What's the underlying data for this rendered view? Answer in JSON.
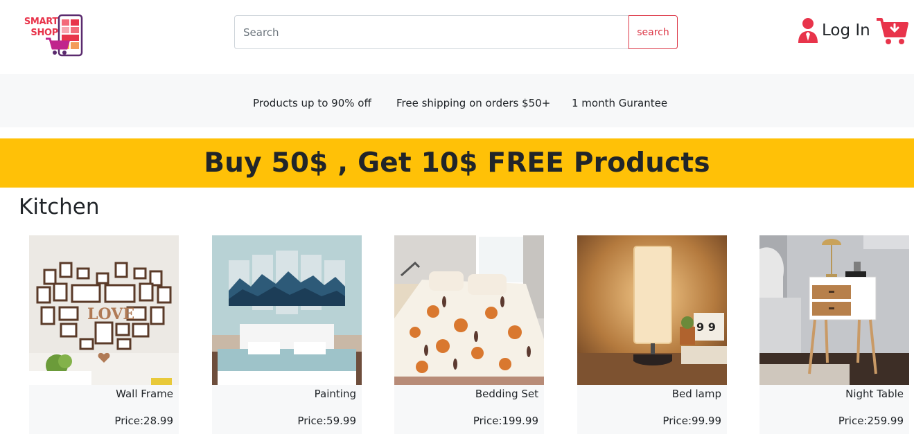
{
  "header": {
    "logo": {
      "line1": "SMART",
      "line2": "SHOP"
    },
    "search": {
      "placeholder": "Search",
      "button_label": "search"
    },
    "login_label": "Log In",
    "brand_color": "#e8344b"
  },
  "info_bar": {
    "items": [
      "Products up to 90% off",
      "Free shipping on orders $50+",
      "1 month Gurantee"
    ]
  },
  "promo": {
    "text": "Buy 50$ , Get 10$ FREE Products",
    "color": "#ffc107"
  },
  "section": {
    "title": "Kitchen",
    "products": [
      {
        "name": "Wall Frame",
        "price": "Price:28.99",
        "image": "wall-frame-image"
      },
      {
        "name": "Painting",
        "price": "Price:59.99",
        "image": "painting-image"
      },
      {
        "name": "Bedding Set",
        "price": "Price:199.99",
        "image": "bedding-set-image"
      },
      {
        "name": "Bed lamp",
        "price": "Price:99.99",
        "image": "bed-lamp-image"
      },
      {
        "name": "Night Table",
        "price": "Price:259.99",
        "image": "night-table-image"
      }
    ]
  }
}
